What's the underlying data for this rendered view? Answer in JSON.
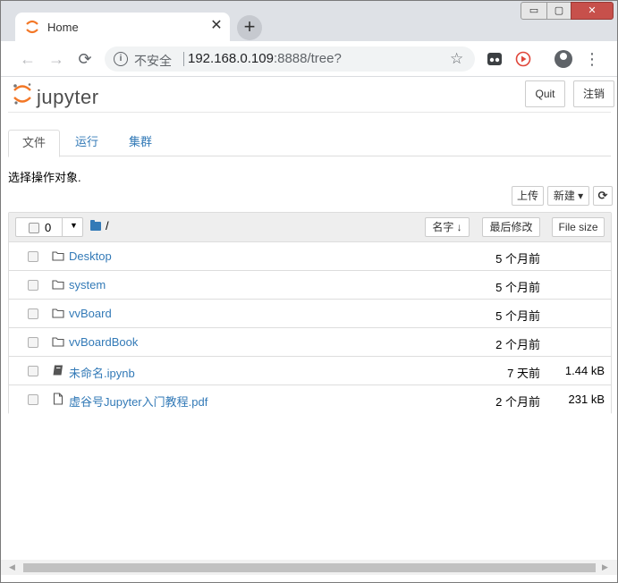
{
  "browser": {
    "tab_title": "Home",
    "tab_close": "✕",
    "new_tab": "+",
    "window_controls": {
      "minimize": "▭",
      "maximize": "▢",
      "close": "✕"
    },
    "address": {
      "security_label": "不安全",
      "host": "192.168.0.109",
      "rest": ":8888/tree?"
    }
  },
  "header": {
    "logo_text": "jupyter",
    "quit_label": "Quit",
    "logout_label": "注销"
  },
  "tabs": [
    {
      "label": "文件",
      "active": true
    },
    {
      "label": "运行",
      "active": false
    },
    {
      "label": "集群",
      "active": false
    }
  ],
  "select_hint": "选择操作对象.",
  "actions": {
    "upload_label": "上传",
    "new_label": "新建 ▾",
    "refresh_label": "⟳"
  },
  "list_header": {
    "selected_count": "0",
    "path": "/",
    "sort_name_label": "名字 ↓",
    "sort_modified_label": "最后修改",
    "sort_size_label": "File size"
  },
  "files": [
    {
      "name": "Desktop",
      "type": "folder",
      "modified": "5 个月前",
      "size": ""
    },
    {
      "name": "system",
      "type": "folder",
      "modified": "5 个月前",
      "size": ""
    },
    {
      "name": "vvBoard",
      "type": "folder",
      "modified": "5 个月前",
      "size": ""
    },
    {
      "name": "vvBoardBook",
      "type": "folder",
      "modified": "2 个月前",
      "size": ""
    },
    {
      "name": "未命名.ipynb",
      "type": "notebook",
      "modified": "7 天前",
      "size": "1.44 kB"
    },
    {
      "name": "虚谷号Jupyter入门教程.pdf",
      "type": "file",
      "modified": "2 个月前",
      "size": "231 kB"
    }
  ],
  "colors": {
    "link": "#337ab7",
    "logo_orange": "#f37726"
  }
}
